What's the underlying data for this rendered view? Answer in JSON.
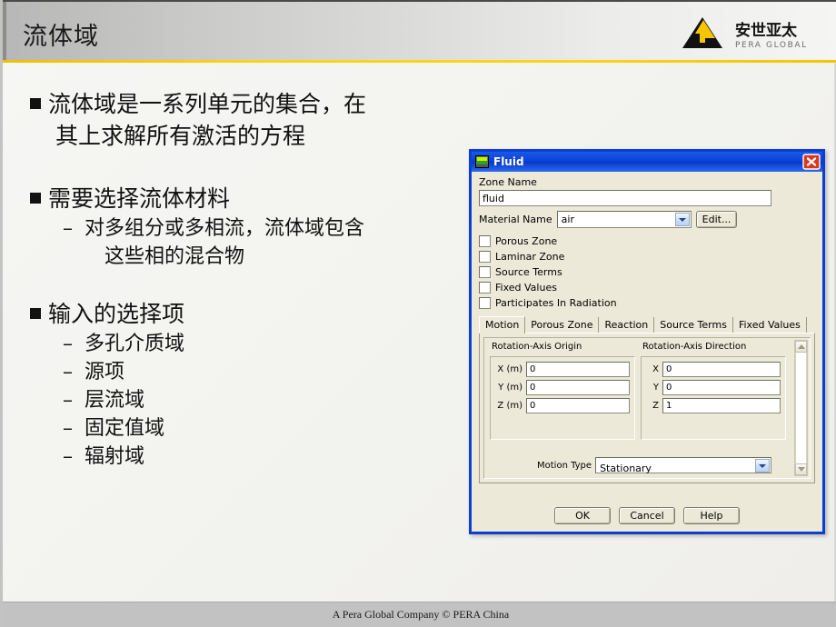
{
  "slide": {
    "title": "流体域",
    "footer": "A Pera Global Company ©  PERA China",
    "accent_color": "#ffd21a",
    "header_gradient_from": "#b7b7b7",
    "header_gradient_to": "#f5f5f3"
  },
  "logo": {
    "cn_text": "安世亚太",
    "en_text": "PERA GLOBAL",
    "mark_color_dark": "#111111",
    "mark_color_accent": "#f5c500"
  },
  "bullets": [
    {
      "level": 1,
      "marker": "square",
      "text": "流体域是一系列单元的集合，在"
    },
    {
      "level": 1,
      "marker": "none",
      "text": "其上求解所有激活的方程"
    },
    {
      "level": 1,
      "marker": "square",
      "text": "需要选择流体材料"
    },
    {
      "level": 2,
      "marker": "dash",
      "text": "对多组分或多相流，流体域包含"
    },
    {
      "level": 2,
      "marker": "none",
      "text": "这些相的混合物"
    },
    {
      "level": 1,
      "marker": "square",
      "text": "输入的选择项"
    },
    {
      "level": 2,
      "marker": "dash",
      "text": "多孔介质域"
    },
    {
      "level": 2,
      "marker": "dash",
      "text": "源项"
    },
    {
      "level": 2,
      "marker": "dash",
      "text": "层流域"
    },
    {
      "level": 2,
      "marker": "dash",
      "text": "固定值域"
    },
    {
      "level": 2,
      "marker": "dash",
      "text": "辐射域"
    }
  ],
  "dialog": {
    "title": "Fluid",
    "title_icon": "fluid-zone-icon",
    "close_icon": "close-icon",
    "titlebar_color": "#0b3fd8",
    "zone_name": {
      "label": "Zone Name",
      "value": "fluid"
    },
    "material": {
      "label": "Material Name",
      "value": "air",
      "edit_label": "Edit..."
    },
    "checkboxes": [
      {
        "label": "Porous Zone",
        "checked": false
      },
      {
        "label": "Laminar Zone",
        "checked": false
      },
      {
        "label": "Source Terms",
        "checked": false
      },
      {
        "label": "Fixed Values",
        "checked": false
      },
      {
        "label": "Participates In Radiation",
        "checked": false
      }
    ],
    "tabs": [
      {
        "label": "Motion",
        "active": true
      },
      {
        "label": "Porous Zone",
        "active": false
      },
      {
        "label": "Reaction",
        "active": false
      },
      {
        "label": "Source Terms",
        "active": false
      },
      {
        "label": "Fixed Values",
        "active": false
      }
    ],
    "motion_tab": {
      "origin_group": {
        "title": "Rotation-Axis Origin",
        "fields": [
          {
            "label": "X (m)",
            "value": "0"
          },
          {
            "label": "Y (m)",
            "value": "0"
          },
          {
            "label": "Z (m)",
            "value": "0"
          }
        ]
      },
      "direction_group": {
        "title": "Rotation-Axis Direction",
        "fields": [
          {
            "label": "X",
            "value": "0"
          },
          {
            "label": "Y",
            "value": "0"
          },
          {
            "label": "Z",
            "value": "1"
          }
        ]
      },
      "motion_type": {
        "label": "Motion Type",
        "value": "Stationary"
      }
    },
    "buttons": [
      {
        "label": "OK"
      },
      {
        "label": "Cancel"
      },
      {
        "label": "Help"
      }
    ]
  }
}
